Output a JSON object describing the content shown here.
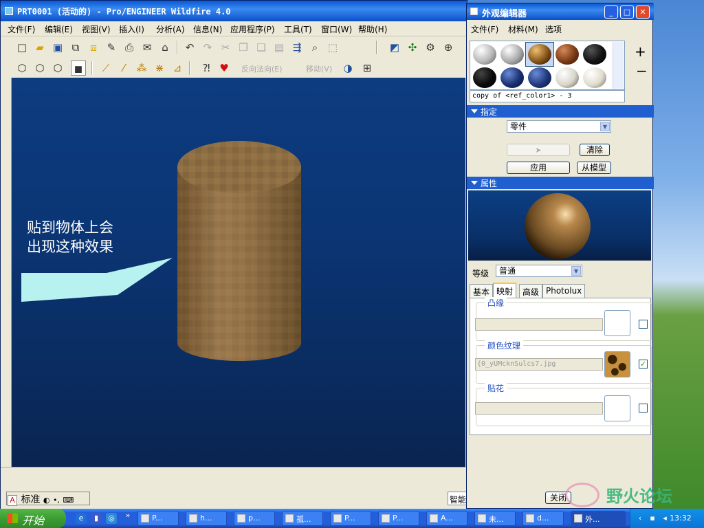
{
  "main_window": {
    "title": "PRT0001 (活动的) - Pro/ENGINEER Wildfire 4.0",
    "menu": [
      "文件(F)",
      "编辑(E)",
      "视图(V)",
      "插入(I)",
      "分析(A)",
      "信息(N)",
      "应用程序(P)",
      "工具(T)",
      "窗口(W)",
      "帮助(H)"
    ],
    "toolbar2_labels": {
      "reverse_normal": "反向法向(E)",
      "move": "移动(V)"
    },
    "status_input_mode": "标准",
    "smart_filter": "智能"
  },
  "viewport": {
    "callout_line1": "贴到物体上会",
    "callout_line2": "出现这种效果"
  },
  "dialog": {
    "title": "外观编辑器",
    "menu": [
      "文件(F)",
      "材料(M)",
      "选项"
    ],
    "selected_appearance": "copy of <ref_color1> - 3",
    "assign_section": {
      "title": "指定",
      "target": "零件",
      "clear_label": "清除",
      "apply_label": "应用",
      "from_model_label": "从模型"
    },
    "properties_section": {
      "title": "属性",
      "level_label": "等级",
      "level_value": "普通",
      "tabs": [
        "基本",
        "映射",
        "高级",
        "Photolux"
      ],
      "active_tab": "映射",
      "bump_label": "凸缘",
      "color_texture_label": "颜色纹理",
      "color_texture_file": "{0_yUMcknSulcs7.jpg",
      "color_texture_checked": true,
      "decal_label": "贴花"
    },
    "close_label": "关闭"
  },
  "taskbar": {
    "start_label": "开始",
    "tasks": [
      "P...",
      "h...",
      "p...",
      "孤...",
      "P...",
      "P...",
      "A...",
      "未...",
      "d...",
      "外..."
    ],
    "clock": "13:32"
  },
  "watermark": "野火论坛",
  "colors": {
    "title_blue": "#0a58d6",
    "section_blue": "#1f5fcf",
    "viewport_top": "#0d3c80",
    "callout_fill": "#b8f2f0",
    "wood_brown": "#8b6a3e"
  }
}
